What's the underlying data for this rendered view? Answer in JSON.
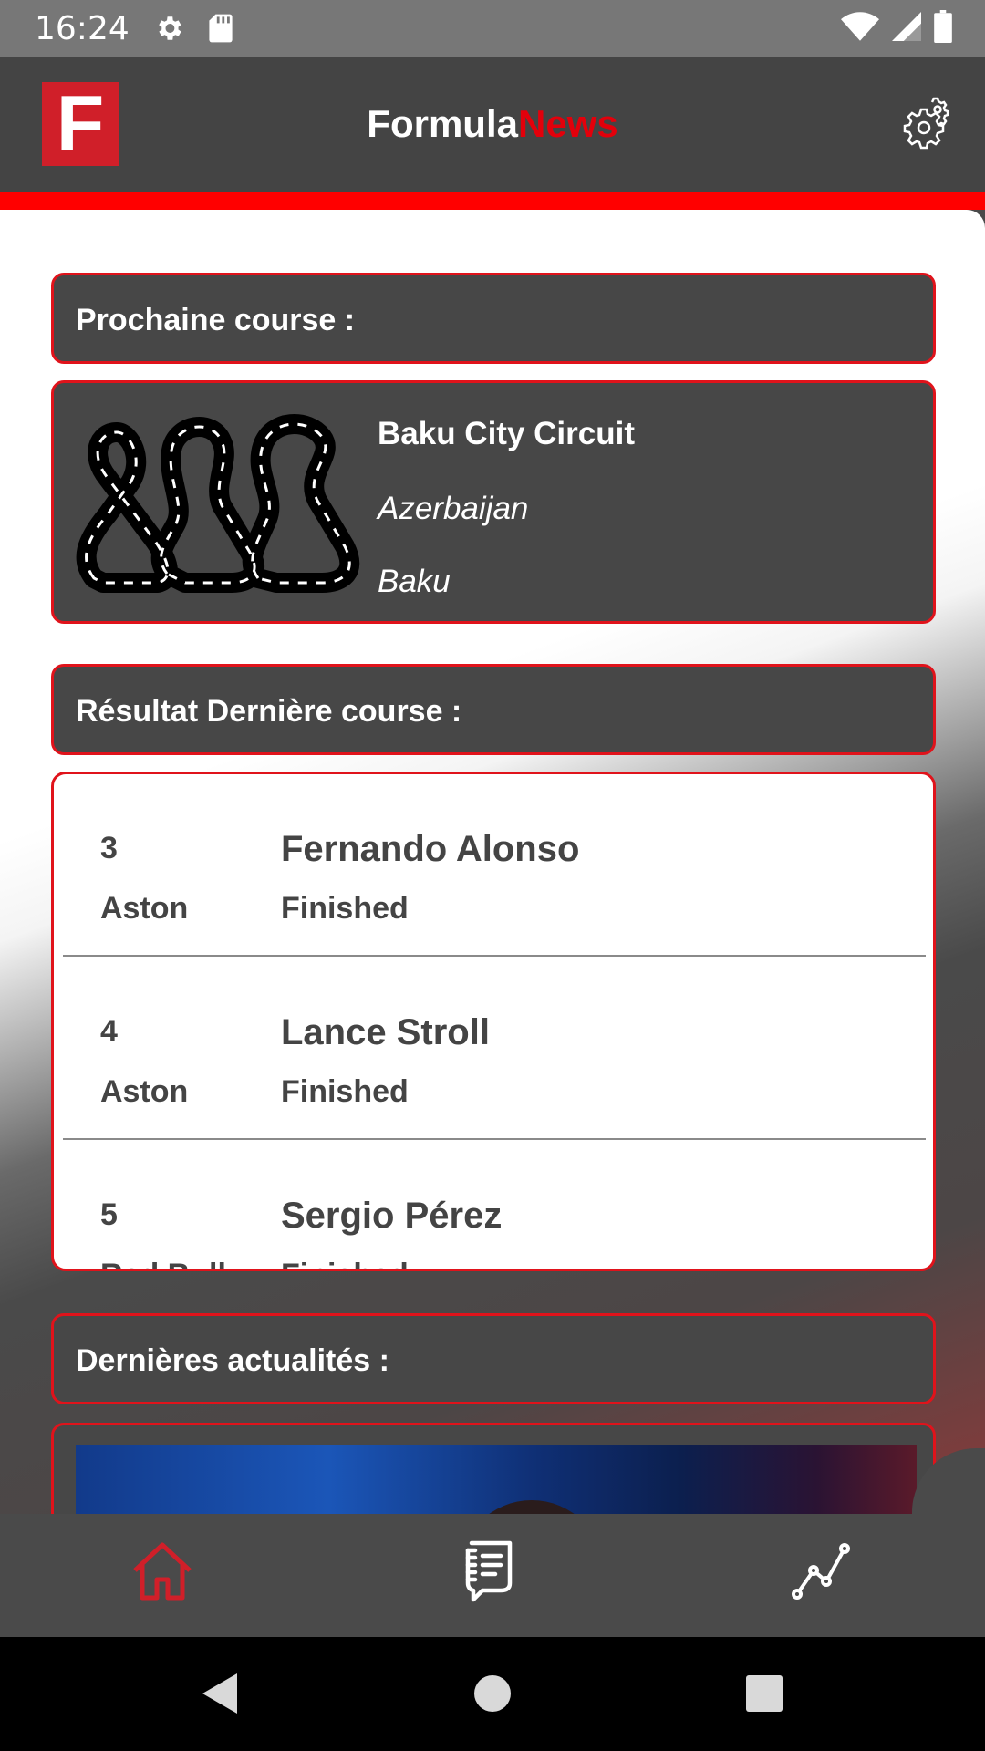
{
  "status_bar": {
    "time": "16:24"
  },
  "app_bar": {
    "title_part1": "Formula",
    "title_part2": "News",
    "logo_letter": "F",
    "accent": "#e3000b"
  },
  "next_race": {
    "header": "Prochaine course :",
    "circuit": "Baku City Circuit",
    "country": "Azerbaijan",
    "city": "Baku"
  },
  "last_results": {
    "header": "Résultat Dernière course :",
    "rows": [
      {
        "position": "3",
        "team": "Aston",
        "driver": "Fernando Alonso",
        "status": "Finished"
      },
      {
        "position": "4",
        "team": "Aston",
        "driver": "Lance Stroll",
        "status": "Finished"
      },
      {
        "position": "5",
        "team": "Red Bull",
        "driver": "Sergio Pérez",
        "status": "Finished"
      }
    ]
  },
  "news": {
    "header": "Dernières actualités :"
  },
  "bottom_nav": {
    "items": [
      {
        "name": "home-icon",
        "active": true
      },
      {
        "name": "news-icon",
        "active": false
      },
      {
        "name": "stats-icon",
        "active": false
      }
    ],
    "active_color": "#d01f29"
  }
}
